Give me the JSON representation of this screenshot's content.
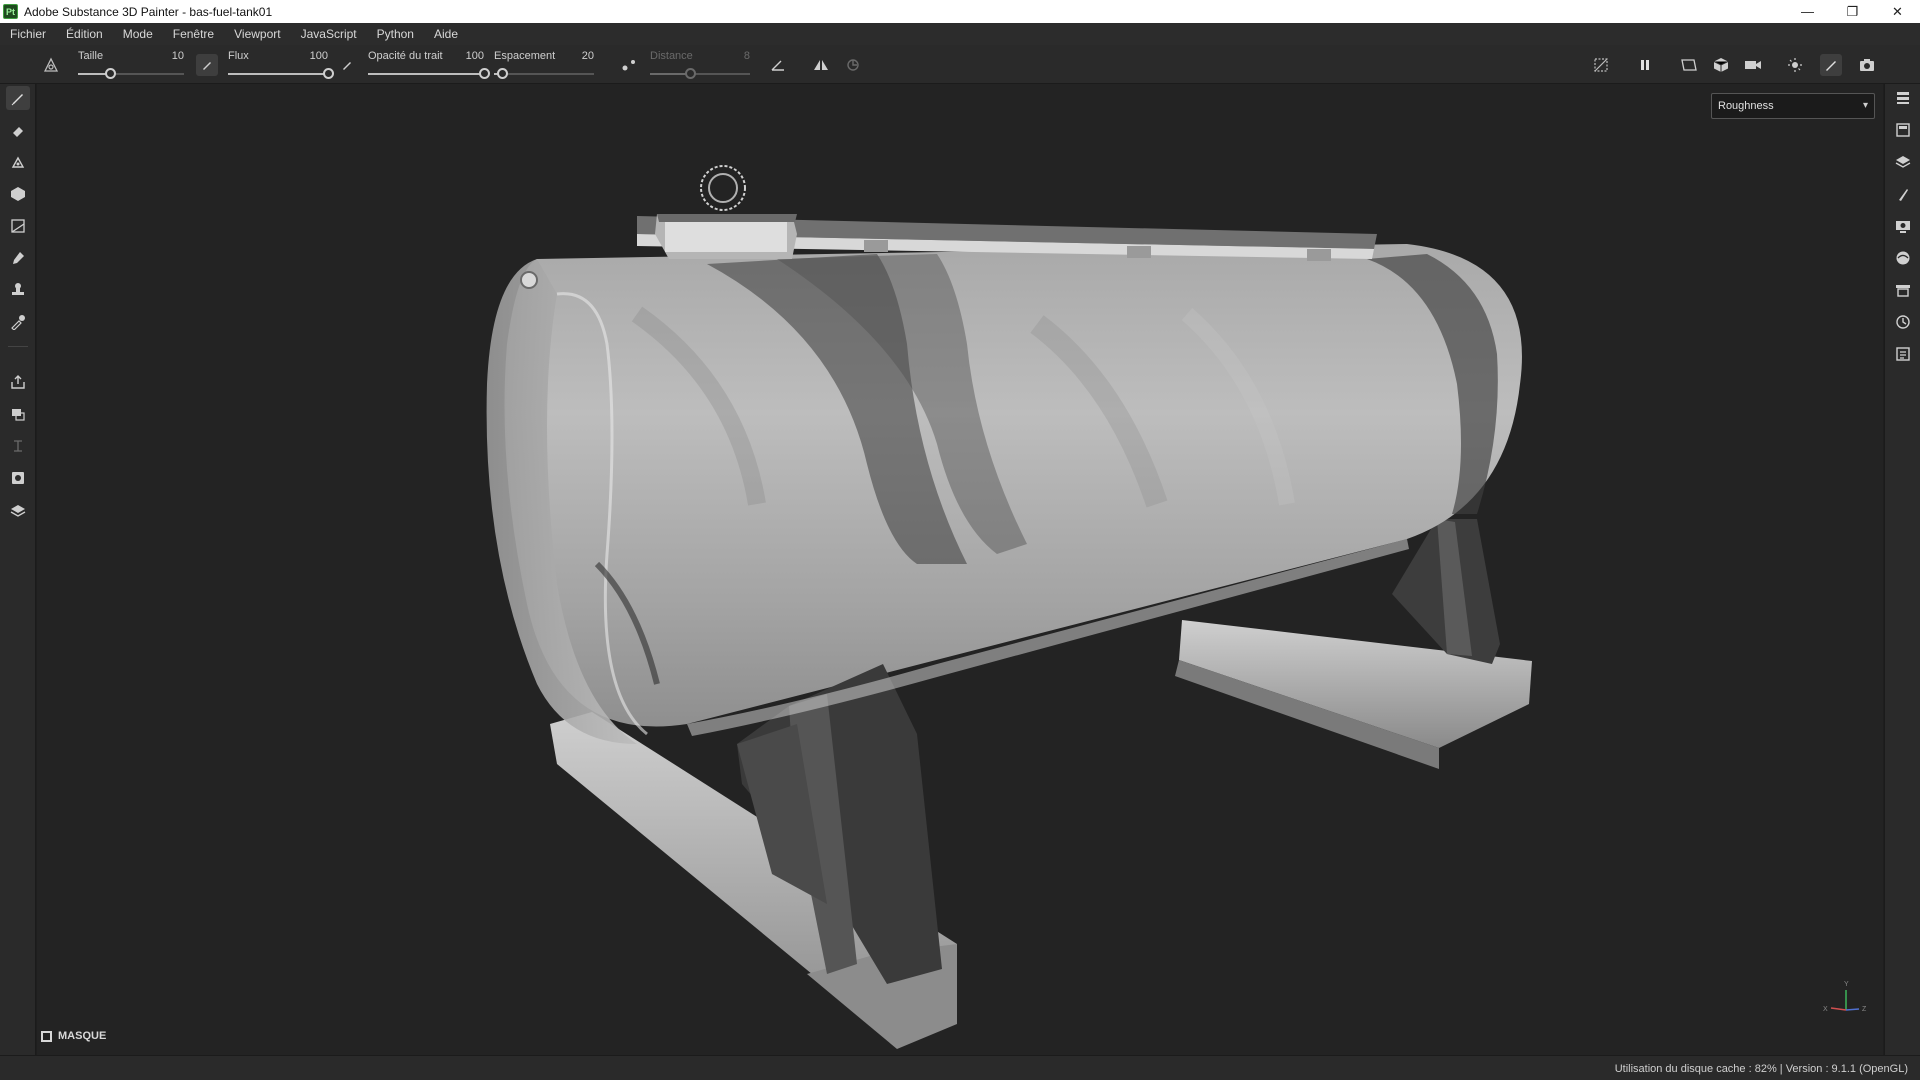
{
  "window": {
    "title": "Adobe Substance 3D Painter - bas-fuel-tank01",
    "logo_text": "Pt",
    "minimize": "—",
    "restore": "❐",
    "close": "✕"
  },
  "menu": [
    "Fichier",
    "Édition",
    "Mode",
    "Fenêtre",
    "Viewport",
    "JavaScript",
    "Python",
    "Aide"
  ],
  "toolbar": {
    "size": {
      "label": "Taille",
      "value": "10",
      "fraction": 0.3
    },
    "flow": {
      "label": "Flux",
      "value": "100",
      "fraction": 1.0
    },
    "stroke_opacity": {
      "label": "Opacité du trait",
      "value": "100",
      "fraction": 1.0
    },
    "spacing": {
      "label": "Espacement",
      "value": "20",
      "fraction": 0.08
    },
    "distance": {
      "label": "Distance",
      "value": "8",
      "fraction": 0.4,
      "disabled": true
    }
  },
  "viewport": {
    "channel": "Roughness",
    "mask_label": "MASQUE",
    "axis_labels": {
      "x": "X",
      "y": "Y",
      "z": "Z"
    }
  },
  "statusbar": {
    "text": "Utilisation du disque cache :  82% | Version : 9.1.1 (OpenGL)"
  },
  "colors": {
    "accent_green": "#3f9f3f",
    "ui_dark": "#2a2a2a",
    "viewport_bg": "#232323"
  }
}
